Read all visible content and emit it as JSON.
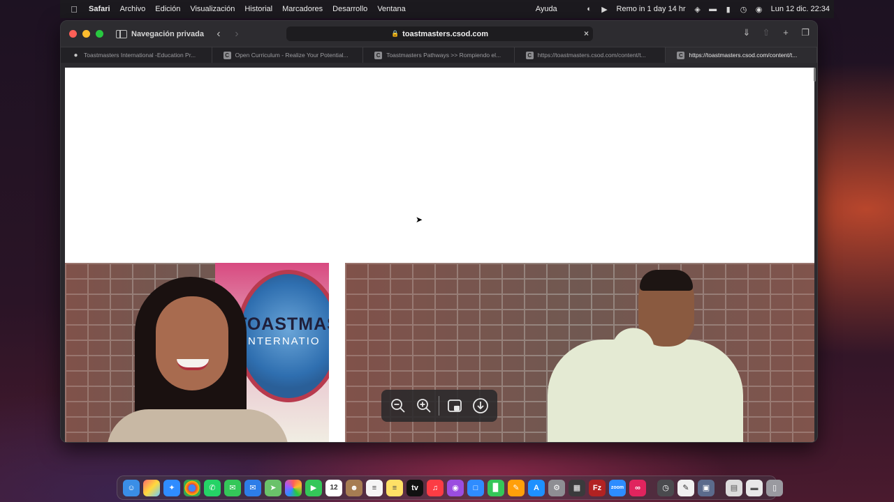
{
  "menubar": {
    "app_name": "Safari",
    "menus": [
      "Archivo",
      "Edición",
      "Visualización",
      "Historial",
      "Marcadores",
      "Desarrollo",
      "Ventana",
      "Ayuda"
    ],
    "status_reminder": "Remo in 1 day 14 hr",
    "datetime": "Lun 12 dic.  22:34"
  },
  "toolbar": {
    "private_label": "Navegación privada",
    "url": "toastmasters.csod.com"
  },
  "tabs": [
    {
      "title": "Toastmasters International -Education Pr...",
      "favicon": "toastmasters-icon",
      "active": false
    },
    {
      "title": "Open Curriculum - Realize Your Potential...",
      "favicon": "C",
      "active": false
    },
    {
      "title": "Toastmasters Pathways >> Rompiendo el...",
      "favicon": "C",
      "active": false
    },
    {
      "title": "https://toastmasters.csod.com/content/t...",
      "favicon": "C",
      "active": false
    },
    {
      "title": "https://toastmasters.csod.com/content/t...",
      "favicon": "C",
      "active": true
    }
  ],
  "content": {
    "logo_text_1": "TOASTMAS",
    "logo_text_2": "NTERNATIO"
  },
  "dock": {
    "calendar_day": "12"
  },
  "colors": {
    "accent_red": "#fe5f57",
    "accent_yellow": "#febc2e",
    "accent_green": "#28c840",
    "menubar_bg": "#1c1a1f"
  }
}
